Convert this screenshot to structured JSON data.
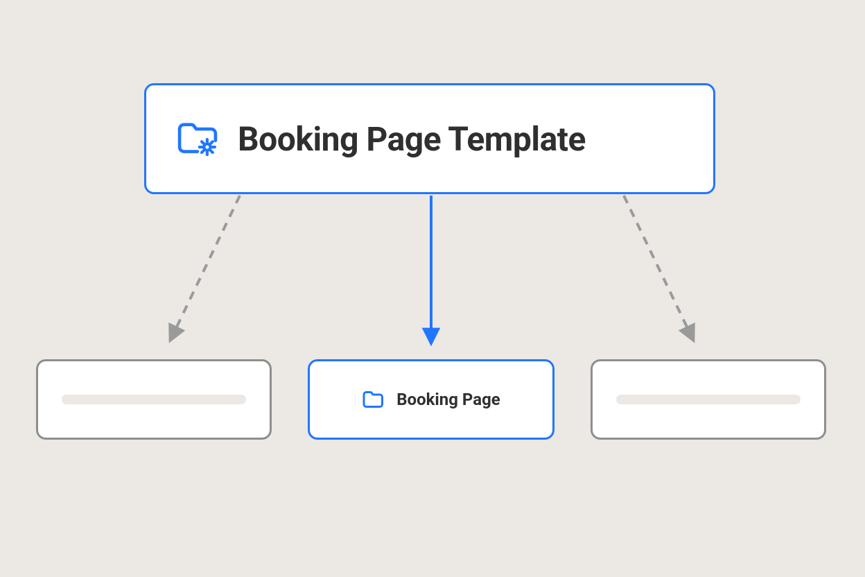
{
  "template": {
    "title": "Booking Page Template",
    "icon": "folder-gear-icon"
  },
  "children": {
    "left": {
      "placeholder": true
    },
    "center": {
      "label": "Booking Page",
      "icon": "folder-icon"
    },
    "right": {
      "placeholder": true
    }
  },
  "colors": {
    "accent": "#2176ff",
    "neutralBorder": "#8e8e8e",
    "placeholder": "#ece9e4",
    "text": "#2f2f30",
    "arrowGray": "#9a9a9a"
  }
}
